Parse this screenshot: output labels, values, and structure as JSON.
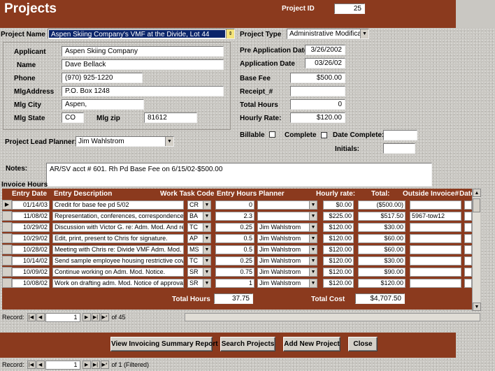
{
  "header": {
    "title": "Projects",
    "project_id_label": "Project ID",
    "project_id": "25"
  },
  "project": {
    "name_label": "Project Name",
    "name": "Aspen Skiing Company's VMF at the Divide, Lot 44",
    "type_label": "Project Type",
    "type": "Administrative Modification"
  },
  "applicant": {
    "applicant_label": "Applicant",
    "applicant": "Aspen Skiing Company",
    "name_label": "Name",
    "name": "Dave Bellack",
    "phone_label": "Phone",
    "phone": "(970) 925-1220",
    "address_label": "MlgAddress",
    "address": "P.O. Box 1248",
    "city_label": "Mlg City",
    "city": "Aspen,",
    "state_label": "Mlg State",
    "state": "CO",
    "zip_label": "Mlg zip",
    "zip": "81612"
  },
  "dates": {
    "pre_app_label": "Pre Application Date",
    "pre_app": "3/26/2002",
    "app_label": "Application Date",
    "app": "03/26/02",
    "base_fee_label": "Base Fee",
    "base_fee": "$500.00",
    "receipt_label": "Receipt_#",
    "receipt": "",
    "total_hours_label": "Total Hours",
    "total_hours": "0",
    "hourly_rate_label": "Hourly Rate:",
    "hourly_rate": "$120.00"
  },
  "flags": {
    "billable_label": "Billable",
    "complete_label": "Complete",
    "date_complete_label": "Date Complete:",
    "date_complete": "",
    "initials_label": "Initials:",
    "initials": ""
  },
  "planner": {
    "label": "Project Lead Planner:",
    "value": "Jim Wahlstrom"
  },
  "notes": {
    "label": "Notes:",
    "value": "AR/SV acct # 601. Rh Pd Base Fee on 6/15/02-$500.00"
  },
  "invoice": {
    "section_label": "Invoice Hours",
    "columns": [
      "Entry Date",
      "Entry Description",
      "Work Task Code",
      "Entry Hours",
      "Planner",
      "Hourly rate:",
      "Total:",
      "Outside Invoice#",
      "Date"
    ],
    "rows": [
      {
        "date": "01/14/03",
        "desc": "Credit for base fee pd 5/02",
        "code": "CR",
        "hours": "0",
        "planner": "",
        "rate": "$0.00",
        "total": "($500.00)",
        "invoice": ""
      },
      {
        "date": "11/08/02",
        "desc": "Representation, conferences, correspondence",
        "code": "BA",
        "hours": "2.3",
        "planner": "",
        "rate": "$225.00",
        "total": "$517.50",
        "invoice": "5967-tow12"
      },
      {
        "date": "10/29/02",
        "desc": "Discussion with Victor G. re: Adm. Mod. And recordi",
        "code": "TC",
        "hours": "0.25",
        "planner": "Jim Wahlstrom",
        "rate": "$120.00",
        "total": "$30.00",
        "invoice": ""
      },
      {
        "date": "10/29/02",
        "desc": "Edit, print, present to Chris for signature.",
        "code": "AP",
        "hours": "0.5",
        "planner": "Jim Wahlstrom",
        "rate": "$120.00",
        "total": "$60.00",
        "invoice": ""
      },
      {
        "date": "10/28/02",
        "desc": "Meeting with Chris re: Divide VMF Adm. Mod. Letter",
        "code": "MS",
        "hours": "0.5",
        "planner": "Jim Wahlstrom",
        "rate": "$120.00",
        "total": "$60.00",
        "invoice": ""
      },
      {
        "date": "10/14/02",
        "desc": "Send sample employee housing restrictive covenant",
        "code": "TC",
        "hours": "0.25",
        "planner": "Jim Wahlstrom",
        "rate": "$120.00",
        "total": "$30.00",
        "invoice": ""
      },
      {
        "date": "10/09/02",
        "desc": "Continue working on Adm. Mod. Notice.",
        "code": "SR",
        "hours": "0.75",
        "planner": "Jim Wahlstrom",
        "rate": "$120.00",
        "total": "$90.00",
        "invoice": ""
      },
      {
        "date": "10/08/02",
        "desc": "Work on drafting adm. Mod. Notice of approval for",
        "code": "SR",
        "hours": "1",
        "planner": "Jim Wahlstrom",
        "rate": "$120.00",
        "total": "$120.00",
        "invoice": ""
      }
    ],
    "total_hours_label": "Total Hours",
    "total_hours": "37.75",
    "total_cost_label": "Total Cost",
    "total_cost": "$4,707.50",
    "nav": {
      "record_label": "Record:",
      "current": "1",
      "of": "of  45"
    }
  },
  "buttons": {
    "summary": "View Invoicing Summary Report",
    "search": "Search Projects",
    "add": "Add New Project",
    "close": "Close"
  },
  "form_nav": {
    "record_label": "Record:",
    "current": "1",
    "of": "of  1 (Filtered)"
  },
  "colors": {
    "header": "#8b3a1e",
    "window": "#c9c7c2"
  }
}
